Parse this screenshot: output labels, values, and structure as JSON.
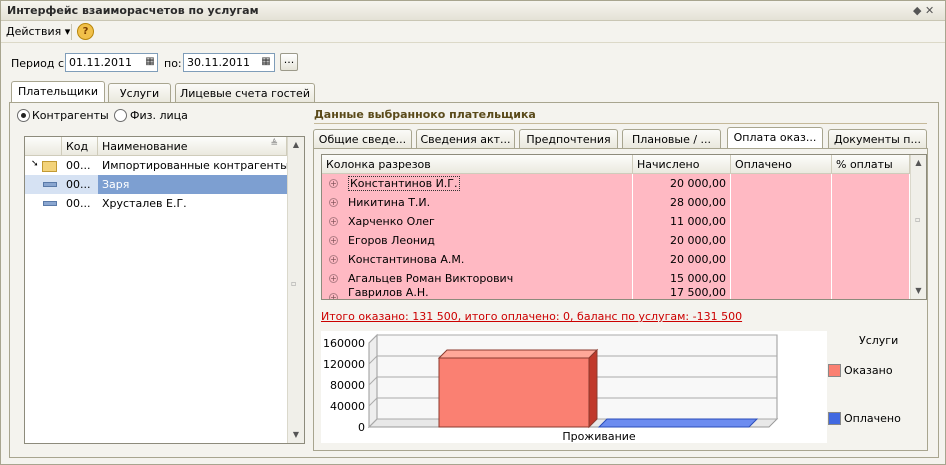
{
  "window": {
    "title": "Интерфейс взаиморасчетов по услугам",
    "controls": "◆ ✕"
  },
  "menu": {
    "actions_label": "Действия ▾",
    "help_label": "?"
  },
  "period": {
    "from_label": "Период с:",
    "from_value": "01.11.2011",
    "to_label": "по:",
    "to_value": "30.11.2011",
    "more_label": "..."
  },
  "main_tabs": [
    {
      "label": "Плательщики",
      "active": true
    },
    {
      "label": "Услуги",
      "active": false
    },
    {
      "label": "Лицевые счета гостей",
      "active": false
    }
  ],
  "filter": {
    "option1": "Контрагенты",
    "option2": "Физ. лица",
    "selected": "option1"
  },
  "left_grid": {
    "columns": [
      "Код",
      "Наименование"
    ],
    "rows": [
      {
        "code": "00...",
        "name": "Импортированные контрагенты",
        "type": "folder",
        "selected": false
      },
      {
        "code": "00...",
        "name": "Заря",
        "type": "item",
        "selected": true
      },
      {
        "code": "00...",
        "name": "Хрусталев Е.Г.",
        "type": "item",
        "selected": false
      }
    ]
  },
  "right": {
    "section_title": "Данные выбранноко плательщика",
    "tabs": [
      {
        "label": "Общие сведе...",
        "active": false
      },
      {
        "label": "Сведения акт...",
        "active": false
      },
      {
        "label": "Предпочтения",
        "active": false
      },
      {
        "label": "Плановые / ...",
        "active": false
      },
      {
        "label": "Оплата оказ...",
        "active": true
      },
      {
        "label": "Документы п...",
        "active": false
      }
    ],
    "grid": {
      "columns": [
        "Колонка разрезов",
        "Начислено",
        "Оплачено",
        "% оплаты"
      ],
      "rows": [
        {
          "name": "Константинов И.Г.",
          "charged": "20 000,00",
          "paid": "",
          "percent": "",
          "focused": true
        },
        {
          "name": "Никитина Т.И.",
          "charged": "28 000,00",
          "paid": "",
          "percent": ""
        },
        {
          "name": "Харченко Олег",
          "charged": "11 000,00",
          "paid": "",
          "percent": ""
        },
        {
          "name": "Егоров Леонид",
          "charged": "20 000,00",
          "paid": "",
          "percent": ""
        },
        {
          "name": "Константинова А.М.",
          "charged": "20 000,00",
          "paid": "",
          "percent": ""
        },
        {
          "name": "Агальцев Роман Викторович",
          "charged": "15 000,00",
          "paid": "",
          "percent": ""
        },
        {
          "name": "Гаврилов А.Н.",
          "charged": "17 500,00",
          "paid": "",
          "percent": ""
        }
      ]
    },
    "total_text": "Итого оказано: 131 500, итого оплачено: 0, баланс по услугам: -131 500"
  },
  "chart_data": {
    "type": "bar",
    "categories": [
      "Проживание"
    ],
    "series": [
      {
        "name": "Оказано",
        "values": [
          131500
        ],
        "color": "#fa8072"
      },
      {
        "name": "Оплачено",
        "values": [
          0
        ],
        "color": "#4169e1"
      }
    ],
    "legend_title": "Услуги",
    "yticks": [
      "160000",
      "120000",
      "80000",
      "40000",
      "0"
    ],
    "ylim": [
      0,
      160000
    ],
    "legend_position": "right",
    "grid": true,
    "style": "3d"
  }
}
